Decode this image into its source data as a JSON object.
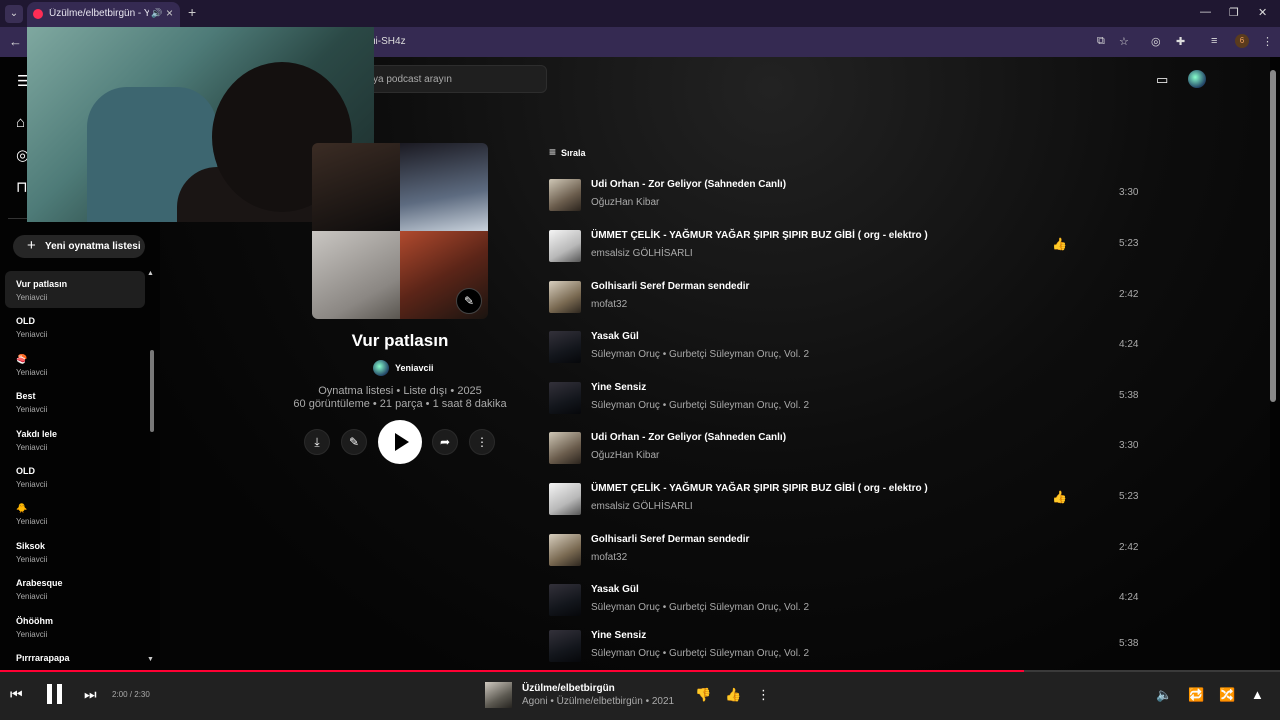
{
  "browser": {
    "tab_title": "Üzülme/elbetbirgün - YouTube Music",
    "url": "ui-SH4z",
    "profile_badge": "6"
  },
  "header": {
    "search_placeholder": "ya podcast arayın"
  },
  "sidebar": {
    "new_playlist_label": "Yeni oynatma listesi",
    "playlists": [
      {
        "name": "Vur patlasın",
        "owner": "Yeniavcii"
      },
      {
        "name": "OLD",
        "owner": "Yeniavcii"
      },
      {
        "name": "🍣",
        "owner": "Yeniavcii"
      },
      {
        "name": "Best",
        "owner": "Yeniavcii"
      },
      {
        "name": "Yakdı lele",
        "owner": "Yeniavcii"
      },
      {
        "name": "OLD",
        "owner": "Yeniavcii"
      },
      {
        "name": "🐥",
        "owner": "Yeniavcii"
      },
      {
        "name": "Siksok",
        "owner": "Yeniavcii"
      },
      {
        "name": "Arabesque",
        "owner": "Yeniavcii"
      },
      {
        "name": "Öhööhm",
        "owner": "Yeniavcii"
      },
      {
        "name": "Pırrrarapapa",
        "owner": ""
      }
    ]
  },
  "playlist": {
    "title": "Vur patlasın",
    "owner": "Yeniavcii",
    "meta_line1": "Oynatma listesi • Liste dışı • 2025",
    "meta_line2": "60 görüntüleme • 21 parça • 1 saat 8 dakika",
    "sort_label": "Sırala"
  },
  "tracks": [
    {
      "title": "Udi Orhan - Zor Geliyor (Sahneden Canlı)",
      "artist": "OğuzHan Kibar",
      "duration": "3:30",
      "liked": false
    },
    {
      "title": "ÜMMET ÇELİK - YAĞMUR YAĞAR ŞIPIR ŞIPIR BUZ GİBİ ( org - elektro )",
      "artist": "emsalsiz GÖLHİSARLI",
      "duration": "5:23",
      "liked": true
    },
    {
      "title": "Golhisarli Seref Derman sendedir",
      "artist": "mofat32",
      "duration": "2:42",
      "liked": false
    },
    {
      "title": "Yasak Gül",
      "artist": "Süleyman Oruç • Gurbetçi Süleyman Oruç, Vol. 2",
      "duration": "4:24",
      "liked": false
    },
    {
      "title": "Yine Sensiz",
      "artist": "Süleyman Oruç • Gurbetçi Süleyman Oruç, Vol. 2",
      "duration": "5:38",
      "liked": false
    },
    {
      "title": "Udi Orhan - Zor Geliyor (Sahneden Canlı)",
      "artist": "OğuzHan Kibar",
      "duration": "3:30",
      "liked": false
    },
    {
      "title": "ÜMMET ÇELİK - YAĞMUR YAĞAR ŞIPIR ŞIPIR BUZ GİBİ ( org - elektro )",
      "artist": "emsalsiz GÖLHİSARLI",
      "duration": "5:23",
      "liked": true
    },
    {
      "title": "Golhisarli Seref Derman sendedir",
      "artist": "mofat32",
      "duration": "2:42",
      "liked": false
    },
    {
      "title": "Yasak Gül",
      "artist": "Süleyman Oruç • Gurbetçi Süleyman Oruç, Vol. 2",
      "duration": "4:24",
      "liked": false
    },
    {
      "title": "Yine Sensiz",
      "artist": "Süleyman Oruç • Gurbetçi Süleyman Oruç, Vol. 2",
      "duration": "5:38",
      "liked": false
    }
  ],
  "player": {
    "time": "2:00 / 2:30",
    "progress_fraction": 0.8,
    "now_playing_title": "Üzülme/elbetbirgün",
    "now_playing_sub": "Agoni • Üzülme/elbetbirgün • 2021",
    "accent_color": "#ff0033"
  }
}
